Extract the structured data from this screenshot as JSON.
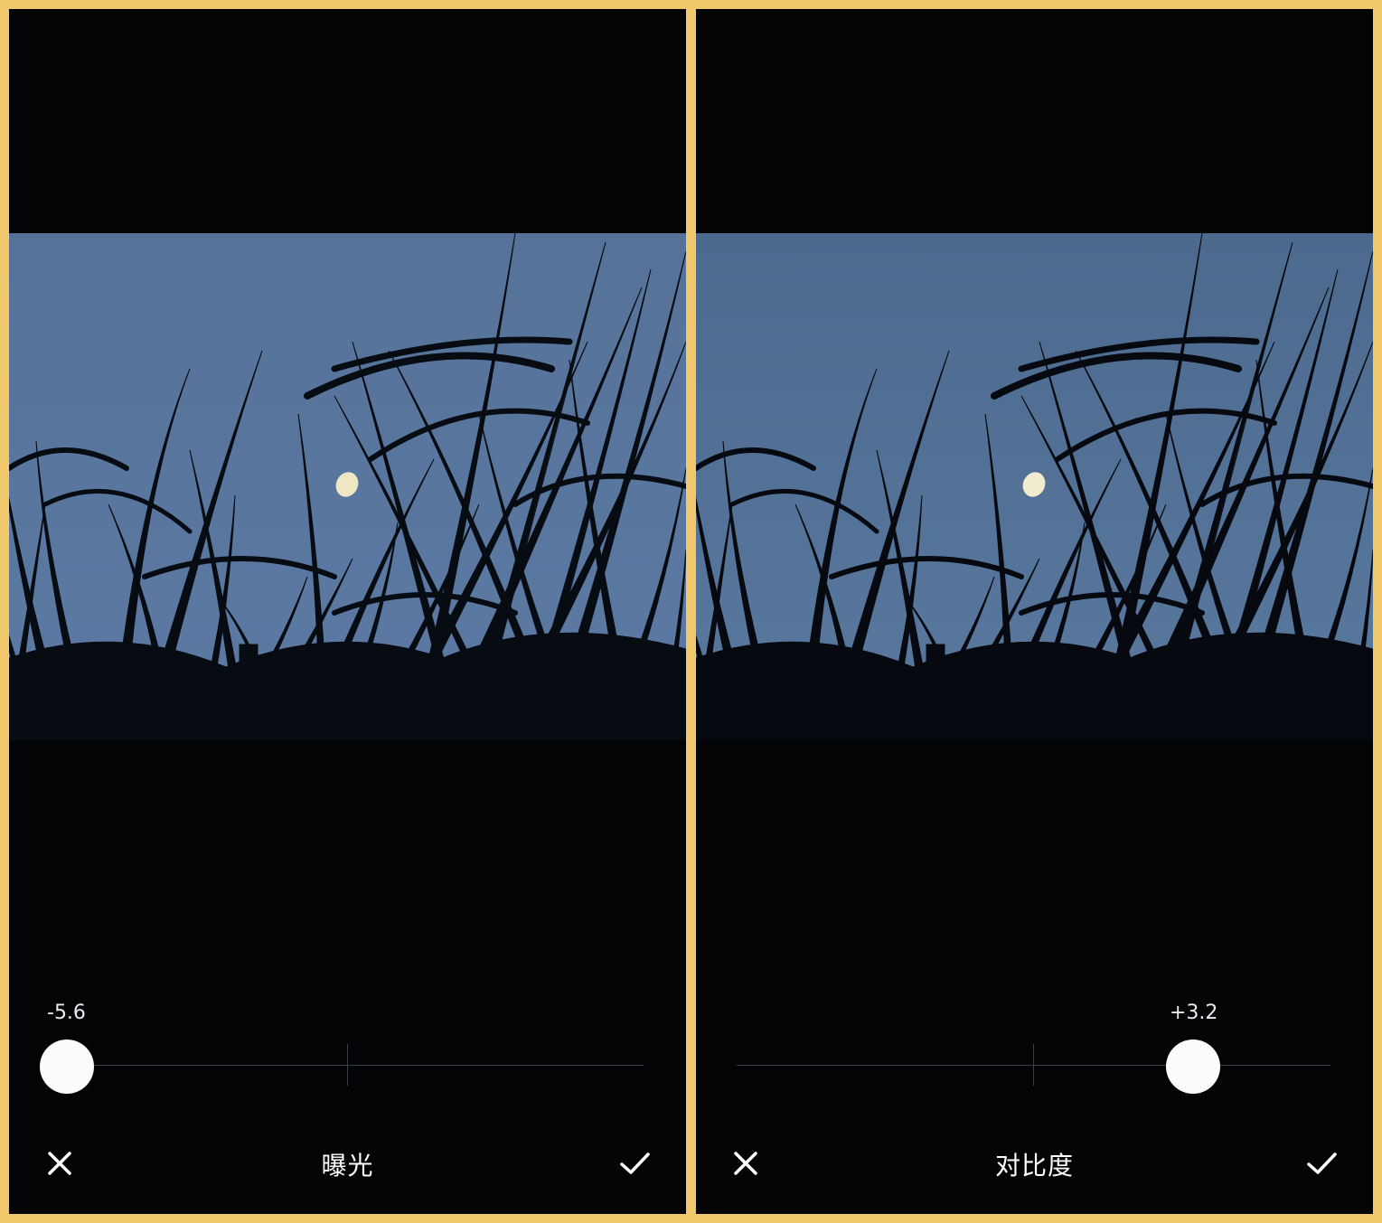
{
  "panels": [
    {
      "tool_name": "曝光",
      "slider_value_label": "-5.6",
      "slider_value": -5.6,
      "cancel_icon": "close-icon",
      "confirm_icon": "checkmark-icon"
    },
    {
      "tool_name": "对比度",
      "slider_value_label": "+3.2",
      "slider_value": 3.2,
      "cancel_icon": "close-icon",
      "confirm_icon": "checkmark-icon"
    }
  ],
  "colors": {
    "frame": "#f1c96c",
    "background": "#030406",
    "sky_left": "#56739a",
    "sky_right": "#4f6b90",
    "silhouette": "#070b12",
    "moon": "#efe7c4",
    "thumb": "#fbfbfb",
    "track": "#3b3f4a",
    "text": "#ffffff"
  }
}
